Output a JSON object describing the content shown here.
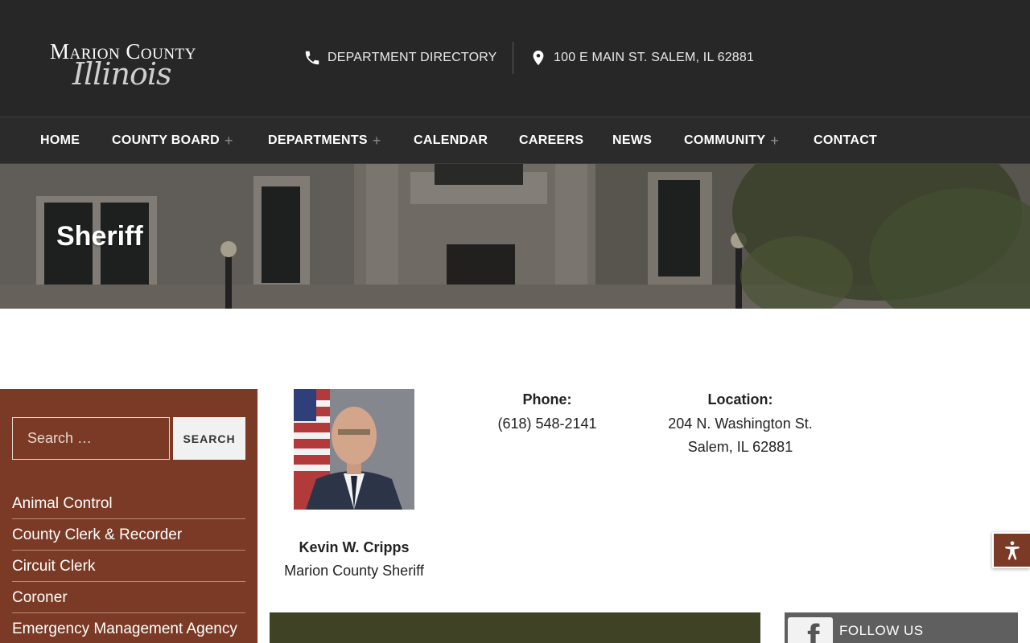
{
  "header": {
    "logo_line1": "Marion County",
    "logo_line2": "Illinois",
    "department_directory": "DEPARTMENT DIRECTORY",
    "address": "100 E MAIN ST. SALEM, IL 62881"
  },
  "nav": {
    "items": [
      {
        "label": "HOME"
      },
      {
        "label": "COUNTY BOARD",
        "plus": "+"
      },
      {
        "label": "DEPARTMENTS",
        "plus": "+"
      },
      {
        "label": "CALENDAR"
      },
      {
        "label": "CAREERS"
      },
      {
        "label": "NEWS"
      },
      {
        "label": "COMMUNITY",
        "plus": "+"
      },
      {
        "label": "CONTACT"
      }
    ]
  },
  "hero": {
    "title": "Sheriff"
  },
  "sidebar": {
    "search_placeholder": "Search …",
    "search_button": "SEARCH",
    "links": [
      "Animal Control",
      "County Clerk & Recorder",
      "Circuit Clerk",
      "Coroner",
      "Emergency Management Agency"
    ]
  },
  "profile": {
    "name": "Kevin W. Cripps",
    "title": "Marion County Sheriff",
    "phone_label": "Phone:",
    "phone": "(618) 548-2141",
    "location_label": "Location:",
    "location_line1": "204 N. Washington St.",
    "location_line2": "Salem, IL 62881"
  },
  "social": {
    "follow_text": "FOLLOW US",
    "facebook_glyph": "f"
  },
  "colors": {
    "header_bg": "#272727",
    "nav_bg": "#2b2b2b",
    "sidebar_bg": "#7a3a25",
    "olive": "#3f4225",
    "accessibility_bg": "#7a3a25"
  },
  "icons": [
    "phone-icon",
    "map-pin-icon",
    "accessibility-icon",
    "facebook-icon"
  ]
}
